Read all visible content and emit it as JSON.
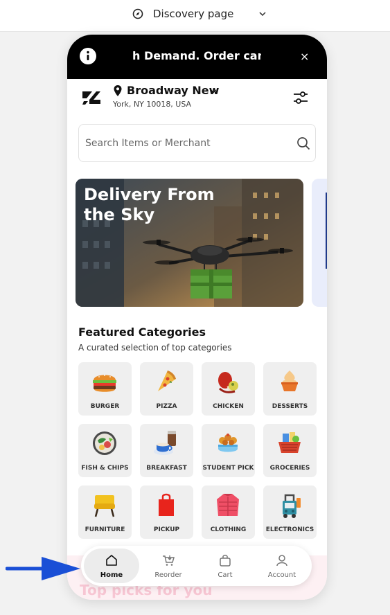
{
  "topbar": {
    "title": "Discovery page",
    "icon": "compass-icon"
  },
  "banner": {
    "text": "h Demand. Order can be",
    "close_label": "×"
  },
  "location": {
    "title": "Broadway New",
    "subtitle": "York, NY 10018, USA"
  },
  "search": {
    "placeholder": "Search Items or Merchant"
  },
  "hero": {
    "title": "Delivery From the Sky"
  },
  "categories": {
    "title": "Featured Categories",
    "subtitle": "A curated selection of top categories",
    "items": [
      {
        "label": "BURGER",
        "icon": "burger-icon"
      },
      {
        "label": "PIZZA",
        "icon": "pizza-icon"
      },
      {
        "label": "CHICKEN",
        "icon": "chicken-icon"
      },
      {
        "label": "DESSERTS",
        "icon": "dessert-icon"
      },
      {
        "label": "FISH & CHIPS",
        "icon": "fish-chips-icon"
      },
      {
        "label": "BREAKFAST",
        "icon": "breakfast-icon"
      },
      {
        "label": "STUDENT PICK",
        "icon": "student-pick-icon"
      },
      {
        "label": "GROCERIES",
        "icon": "groceries-icon"
      },
      {
        "label": "FURNITURE",
        "icon": "furniture-icon"
      },
      {
        "label": "PICKUP",
        "icon": "pickup-icon"
      },
      {
        "label": "CLOTHING",
        "icon": "clothing-icon"
      },
      {
        "label": "ELECTRONICS",
        "icon": "electronics-icon"
      }
    ]
  },
  "top_picks": {
    "title": "Top picks for you"
  },
  "nav": {
    "items": [
      {
        "label": "Home",
        "icon": "home-icon",
        "active": true
      },
      {
        "label": "Reorder",
        "icon": "reorder-icon",
        "active": false
      },
      {
        "label": "Cart",
        "icon": "cart-icon",
        "active": false
      },
      {
        "label": "Account",
        "icon": "account-icon",
        "active": false
      }
    ]
  },
  "colors": {
    "accent": "#000000",
    "arrow": "#1a4fd6",
    "tile_bg": "#efefef"
  }
}
